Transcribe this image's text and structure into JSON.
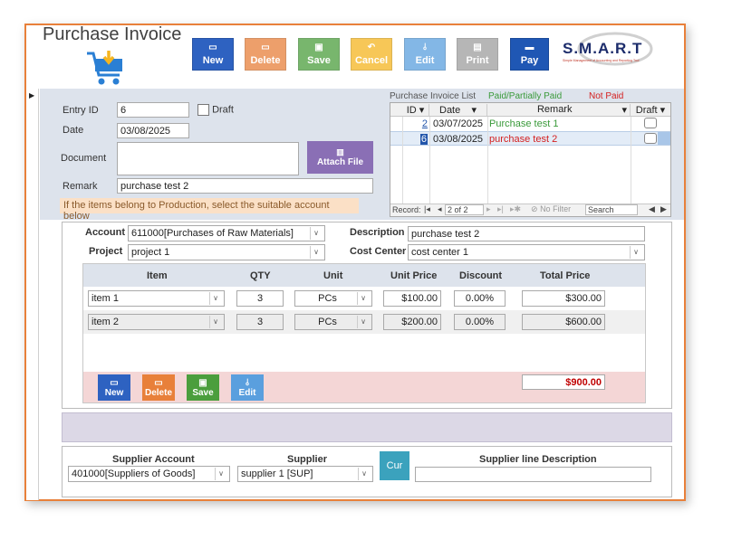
{
  "title": "Purchase Invoice",
  "toolbar": {
    "new": "New",
    "delete": "Delete",
    "save": "Save",
    "cancel": "Cancel",
    "edit": "Edit",
    "print": "Print",
    "pay": "Pay"
  },
  "logo": {
    "text": "S.M.A.R.T",
    "tagline": "Simple Management of Accounting and Reporting Tool"
  },
  "colors": {
    "accent": "#e8803a",
    "new": "#2e62c1",
    "delete": "#e8803a",
    "save": "#4b9e3d",
    "cancel": "#f5b51f",
    "edit": "#5a9fde",
    "print": "#9e9e9e",
    "pay": "#1f57b4",
    "attach": "#8a6fb5"
  },
  "header": {
    "entry_id_label": "Entry ID",
    "entry_id": "6",
    "draft_label": "Draft",
    "date_label": "Date",
    "date": "03/08/2025",
    "document_label": "Document",
    "attach_label": "Attach File",
    "remark_label": "Remark",
    "remark": "purchase test 2",
    "hint": "If the items belong to Production,  select the suitable account below"
  },
  "list": {
    "title": "Purchase Invoice List",
    "paid_label": "Paid/Partially Paid",
    "notpaid_label": "Not Paid",
    "columns": [
      "ID",
      "Date",
      "Remark",
      "Draft"
    ],
    "rows": [
      {
        "id": "2",
        "date": "03/07/2025",
        "remark": "Purchase test 1"
      },
      {
        "id": "6",
        "date": "03/08/2025",
        "remark": "purchase test 2"
      }
    ],
    "nav": {
      "record_label": "Record:",
      "position": "2 of 2",
      "filter": "No Filter",
      "search": "Search"
    }
  },
  "detail": {
    "account_label": "Account",
    "account": "611000[Purchases of Raw Materials]",
    "description_label": "Description",
    "description": "purchase test 2",
    "project_label": "Project",
    "project": "project 1",
    "cost_center_label": "Cost Center",
    "cost_center": "cost center 1",
    "columns": [
      "Item",
      "QTY",
      "Unit",
      "Unit Price",
      "Discount",
      "Total Price"
    ],
    "rows": [
      {
        "item": "item 1",
        "qty": "3",
        "unit": "PCs",
        "price": "$100.00",
        "discount": "0.00%",
        "total": "$300.00"
      },
      {
        "item": "item 2",
        "qty": "3",
        "unit": "PCs",
        "price": "$200.00",
        "discount": "0.00%",
        "total": "$600.00"
      }
    ],
    "grand_total": "$900.00",
    "buttons": {
      "new": "New",
      "delete": "Delete",
      "save": "Save",
      "edit": "Edit"
    }
  },
  "supplier": {
    "account_label": "Supplier Account",
    "account": "401000[Suppliers of Goods]",
    "supplier_label": "Supplier",
    "supplier": "supplier 1 [SUP]",
    "cur_label": "Cur",
    "line_desc_label": "Supplier line Description",
    "line_desc": ""
  }
}
